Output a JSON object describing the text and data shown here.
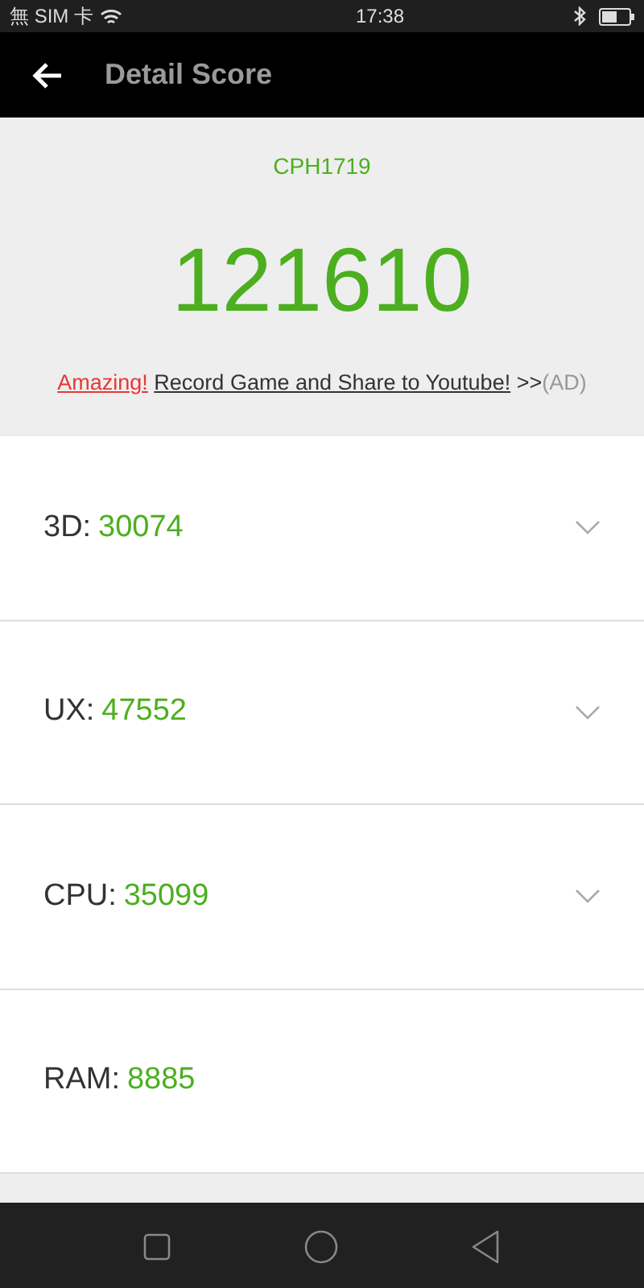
{
  "status_bar": {
    "carrier": "無 SIM 卡",
    "time": "17:38"
  },
  "app_bar": {
    "title": "Detail Score"
  },
  "summary": {
    "device": "CPH1719",
    "score": "121610",
    "ad": {
      "highlight": "Amazing!",
      "link": "Record Game and Share to Youtube!",
      "arrows": ">>",
      "tag": "(AD)"
    }
  },
  "scores": [
    {
      "label": "3D:",
      "value": "30074",
      "expandable": true
    },
    {
      "label": "UX:",
      "value": "47552",
      "expandable": true
    },
    {
      "label": "CPU:",
      "value": "35099",
      "expandable": true
    },
    {
      "label": "RAM:",
      "value": "8885",
      "expandable": false
    }
  ]
}
